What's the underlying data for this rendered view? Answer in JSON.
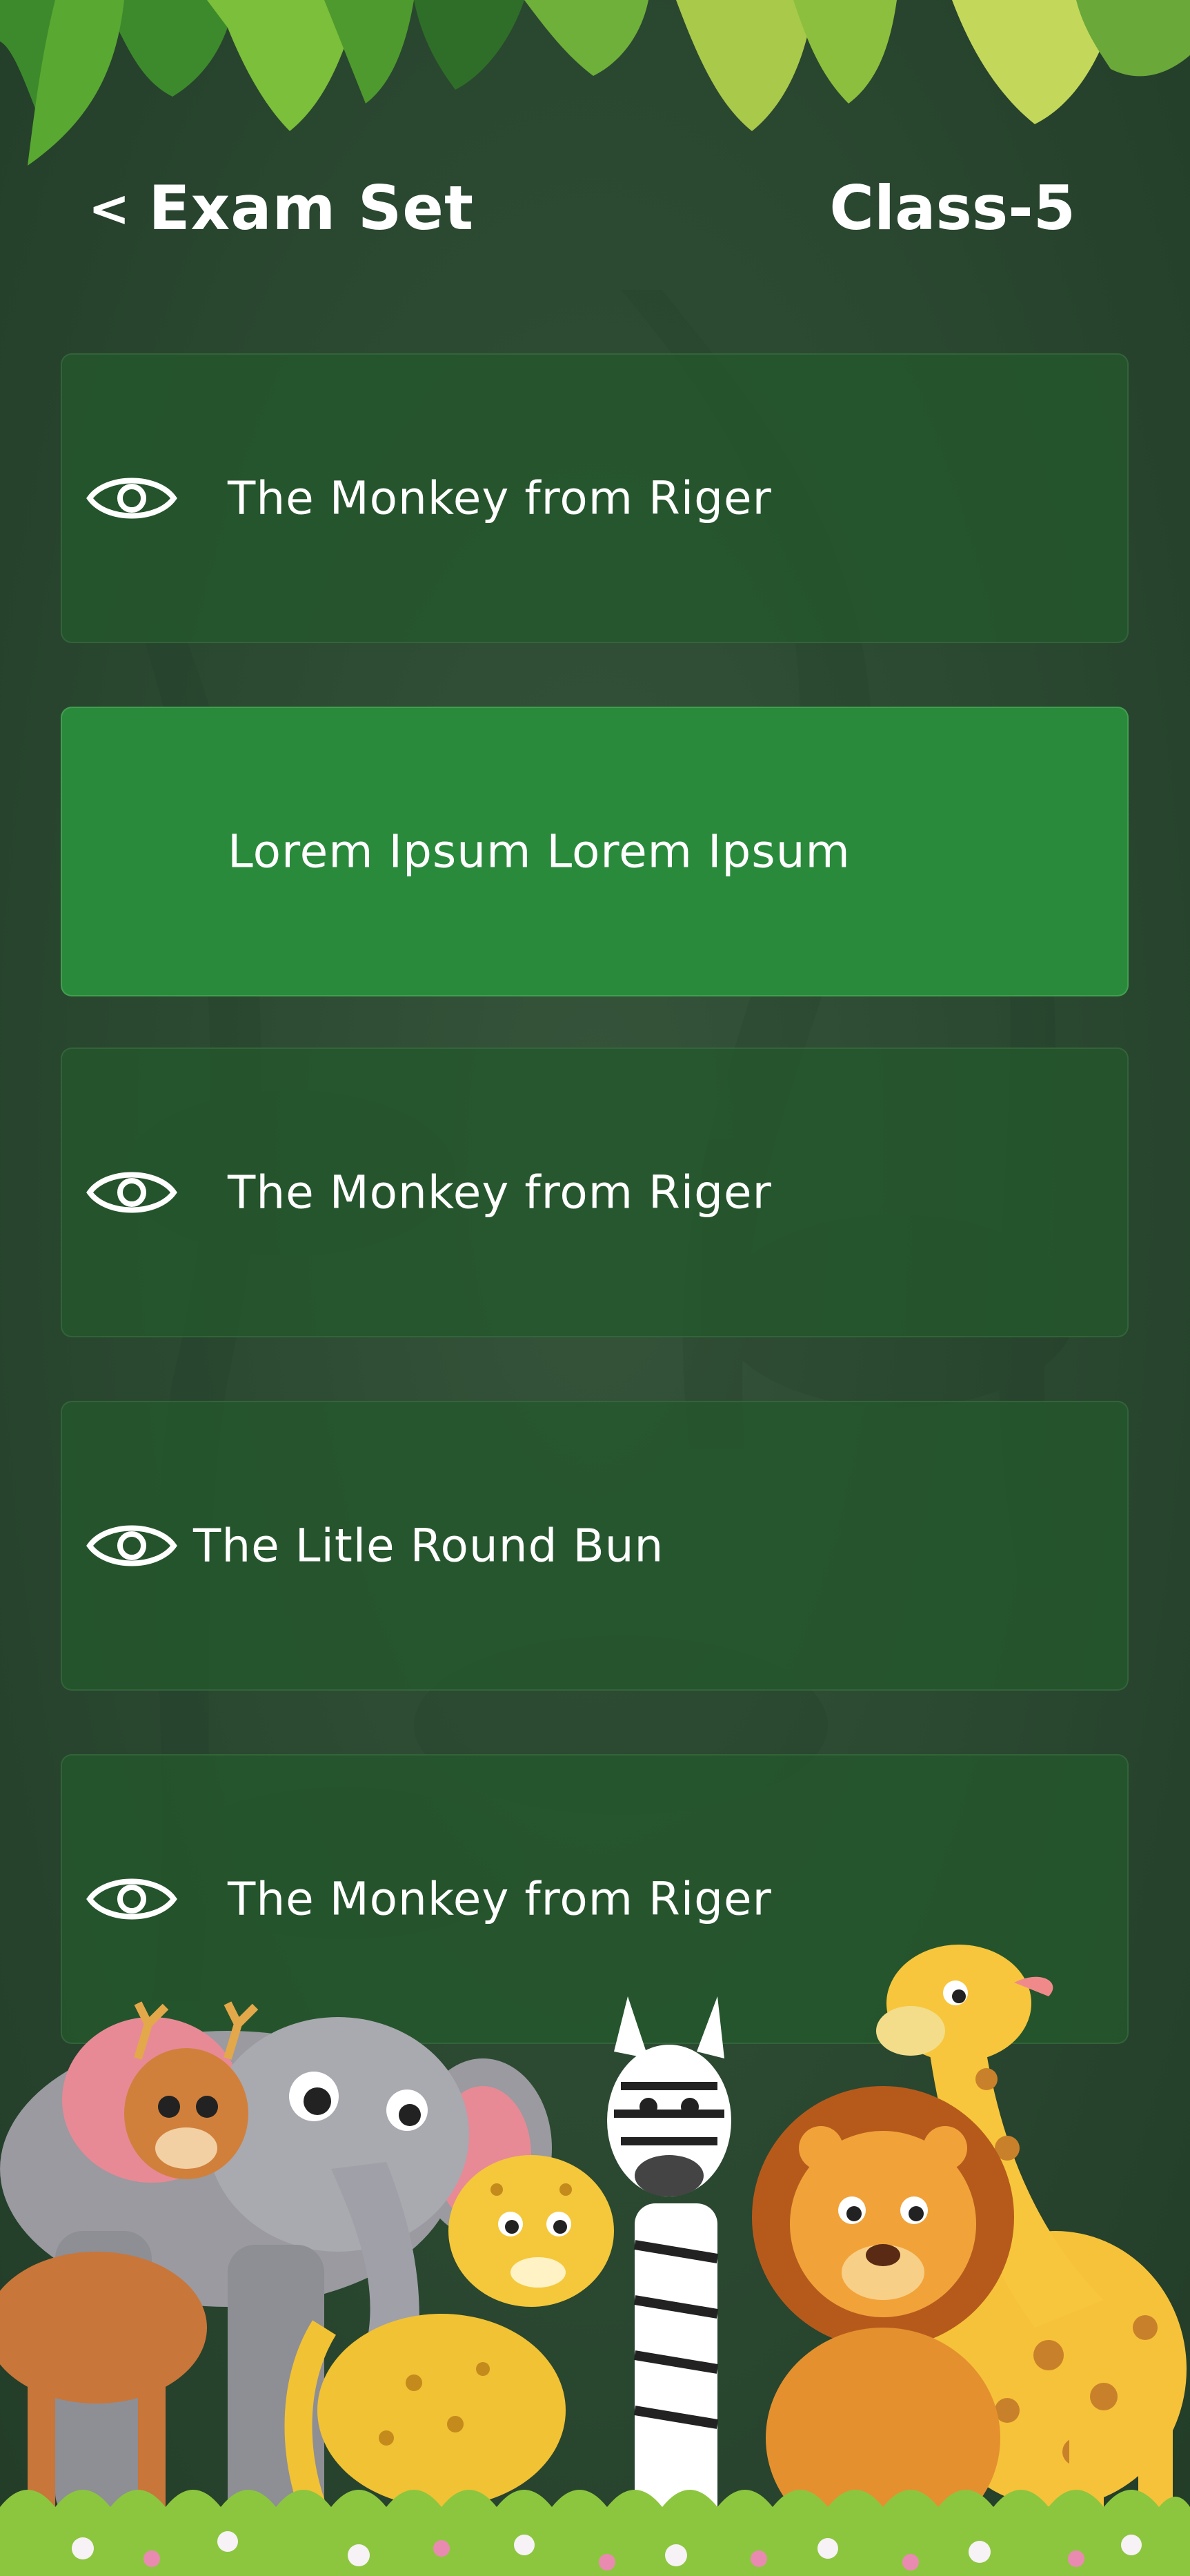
{
  "header": {
    "back_chevron": "<",
    "title": "Exam Set",
    "class_label": "Class-5"
  },
  "exam_items": [
    {
      "label": "The Monkey from Riger",
      "icon": "eye-icon",
      "selected": false
    },
    {
      "label": "Lorem Ipsum Lorem Ipsum",
      "icon": null,
      "selected": true
    },
    {
      "label": "The Monkey from Riger",
      "icon": "eye-icon",
      "selected": false
    },
    {
      "label": "The Litle Round Bun",
      "icon": "eye-icon",
      "selected": false
    },
    {
      "label": "The Monkey from Riger",
      "icon": "eye-icon",
      "selected": false
    }
  ],
  "colors": {
    "background": "#2c4a32",
    "card": "#24582c",
    "card_selected": "#2a8a3c",
    "text": "#ffffff"
  }
}
